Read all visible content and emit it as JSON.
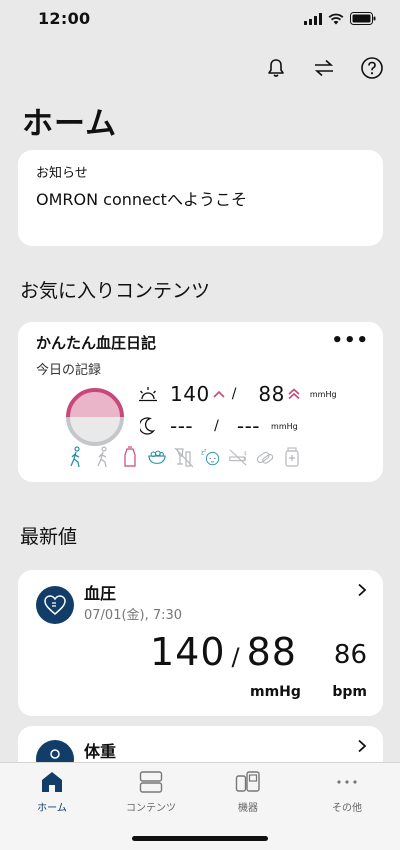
{
  "status": {
    "time": "12:00"
  },
  "header": {
    "title": "ホーム"
  },
  "notice": {
    "label": "お知らせ",
    "message": "OMRON connectへようこそ"
  },
  "favorites": {
    "section_title": "お気に入りコンテンツ",
    "card_title": "かんたん血圧日記",
    "subtitle": "今日の記録",
    "morning": {
      "systolic": "140",
      "slash": "/",
      "diastolic": "88",
      "unit": "mmHg"
    },
    "evening": {
      "systolic": "---",
      "slash": "/",
      "diastolic": "---",
      "unit": "mmHg"
    },
    "more_label": "•••"
  },
  "latest": {
    "section_title": "最新値",
    "blood_pressure": {
      "name": "血圧",
      "date": "07/01(金), 7:30",
      "systolic": "140",
      "slash": "/",
      "diastolic": "88",
      "pulse": "86",
      "unit_bp": "mmHg",
      "unit_pulse": "bpm"
    },
    "weight": {
      "name": "体重"
    }
  },
  "tabs": [
    {
      "label": "ホーム",
      "active": true
    },
    {
      "label": "コンテンツ",
      "active": false
    },
    {
      "label": "機器",
      "active": false
    },
    {
      "label": "その他",
      "active": false
    }
  ],
  "colors": {
    "accent": "#123d69",
    "pink": "#c9487c",
    "teal": "#2b8fa8",
    "background": "#e9e9e9"
  }
}
